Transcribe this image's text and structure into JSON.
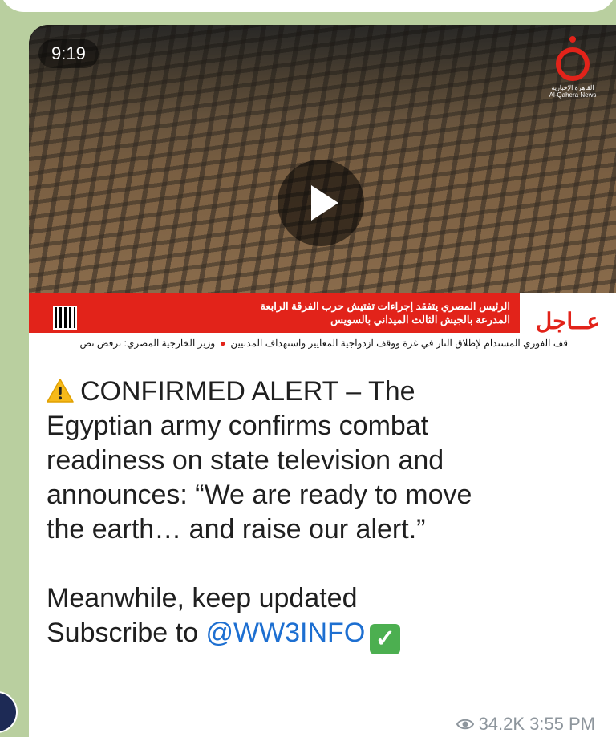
{
  "video": {
    "duration": "9:19",
    "logo_text": "القاهرة الإخبارية\nAl-Qahera News",
    "breaking_label": "عــاجل",
    "headline_line1": "الرئيس المصري يتفقد إجراءات تفتيش حرب الفرقة الرابعة",
    "headline_line2": "المدرعة بالجيش الثالث الميداني بالسويس",
    "ticker_1": "قف الفوري المستدام لإطلاق النار في غزة ووقف ازدواجية المعايير واستهداف المدنيين",
    "ticker_2": "وزير الخارجية المصري: نرفض تص"
  },
  "message": {
    "line1": "CONFIRMED ALERT – The",
    "line2": "Egyptian army confirms combat",
    "line3": "readiness on state television and",
    "line4": "announces: “We are ready to move",
    "line5": "the earth… and raise our alert.”",
    "line6": "Meanwhile, keep updated",
    "subscribe_prefix": "Subscribe to ",
    "mention": "@WW3INFO",
    "check_glyph": "✓"
  },
  "meta": {
    "views": "34.2K",
    "time": "3:55 PM"
  },
  "colors": {
    "accent_red": "#e2231a",
    "link_blue": "#1d6fd1",
    "meta_gray": "#8e969d"
  },
  "icons": [
    "warning-icon",
    "check-icon",
    "eye-icon",
    "play-icon"
  ]
}
